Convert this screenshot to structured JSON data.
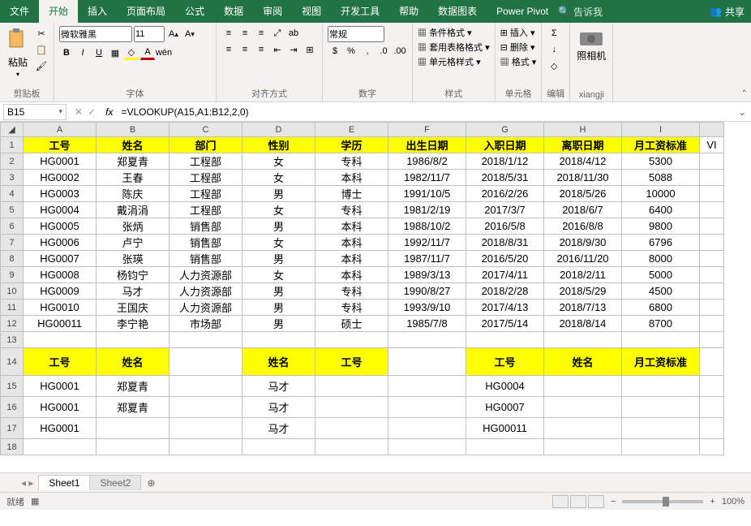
{
  "tabs": {
    "file": "文件",
    "home": "开始",
    "insert": "插入",
    "layout": "页面布局",
    "formulas": "公式",
    "data": "数据",
    "review": "审阅",
    "view": "视图",
    "dev": "开发工具",
    "help": "帮助",
    "chart": "数据图表",
    "powerpivot": "Power Pivot",
    "tellme": "告诉我",
    "share": "共享"
  },
  "ribbon": {
    "clipboard": {
      "label": "剪贴板",
      "paste": "粘贴"
    },
    "font": {
      "label": "字体",
      "name": "微软雅黑",
      "size": "11"
    },
    "align": {
      "label": "对齐方式"
    },
    "number": {
      "label": "数字",
      "format": "常规"
    },
    "styles": {
      "label": "样式",
      "cond": "条件格式",
      "table": "套用表格格式",
      "cell": "单元格样式"
    },
    "cells": {
      "label": "单元格",
      "insert": "插入",
      "delete": "删除",
      "format": "格式"
    },
    "editing": {
      "label": "编辑"
    },
    "camera": {
      "label": "照相机"
    },
    "xiangji": "xiangji"
  },
  "namebox": "B15",
  "formula": "=VLOOKUP(A15,A1:B12,2,0)",
  "cols": [
    "A",
    "B",
    "C",
    "D",
    "E",
    "F",
    "G",
    "H",
    "I",
    ""
  ],
  "headers1": [
    "工号",
    "姓名",
    "部门",
    "性别",
    "学历",
    "出生日期",
    "入职日期",
    "离职日期",
    "月工资标准"
  ],
  "overflow_j1": "VI",
  "rows": [
    [
      "HG0001",
      "郑夏青",
      "工程部",
      "女",
      "专科",
      "1986/8/2",
      "2018/1/12",
      "2018/4/12",
      "5300"
    ],
    [
      "HG0002",
      "王春",
      "工程部",
      "女",
      "本科",
      "1982/11/7",
      "2018/5/31",
      "2018/11/30",
      "5088"
    ],
    [
      "HG0003",
      "陈庆",
      "工程部",
      "男",
      "博士",
      "1991/10/5",
      "2016/2/26",
      "2018/5/26",
      "10000"
    ],
    [
      "HG0004",
      "戴涓涓",
      "工程部",
      "女",
      "专科",
      "1981/2/19",
      "2017/3/7",
      "2018/6/7",
      "6400"
    ],
    [
      "HG0005",
      "张炳",
      "销售部",
      "男",
      "本科",
      "1988/10/2",
      "2016/5/8",
      "2016/8/8",
      "9800"
    ],
    [
      "HG0006",
      "卢宁",
      "销售部",
      "女",
      "本科",
      "1992/11/7",
      "2018/8/31",
      "2018/9/30",
      "6796"
    ],
    [
      "HG0007",
      "张瑛",
      "销售部",
      "男",
      "本科",
      "1987/11/7",
      "2016/5/20",
      "2016/11/20",
      "8000"
    ],
    [
      "HG0008",
      "杨钧宁",
      "人力资源部",
      "女",
      "本科",
      "1989/3/13",
      "2017/4/11",
      "2018/2/11",
      "5000"
    ],
    [
      "HG0009",
      "马才",
      "人力资源部",
      "男",
      "专科",
      "1990/8/27",
      "2018/2/28",
      "2018/5/29",
      "4500"
    ],
    [
      "HG0010",
      "王国庆",
      "人力资源部",
      "男",
      "专科",
      "1993/9/10",
      "2017/4/13",
      "2018/7/13",
      "6800"
    ],
    [
      "HG00011",
      "李宁艳",
      "市场部",
      "男",
      "硕士",
      "1985/7/8",
      "2017/5/14",
      "2018/8/14",
      "8700"
    ]
  ],
  "row14": {
    "A": "工号",
    "B": "姓名",
    "D": "姓名",
    "E": "工号",
    "G": "工号",
    "H": "姓名",
    "I": "月工资标准"
  },
  "row15": {
    "A": "HG0001",
    "B": "郑夏青",
    "D": "马才",
    "G": "HG0004"
  },
  "row16": {
    "A": "HG0001",
    "B": "郑夏青",
    "D": "马才",
    "G": "HG0007"
  },
  "row17": {
    "A": "HG0001",
    "D": "马才",
    "G": "HG00011"
  },
  "sheets": {
    "s1": "Sheet1",
    "s2": "Sheet2"
  },
  "status": {
    "ready": "就绪",
    "zoom": "100%"
  }
}
